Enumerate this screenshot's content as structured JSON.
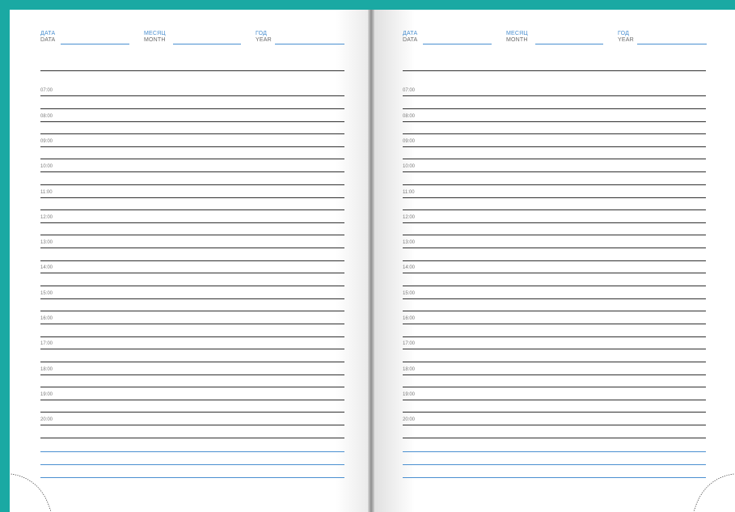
{
  "header_fields": [
    {
      "ru": "ДАТА",
      "en": "DATA"
    },
    {
      "ru": "МЕСЯЦ",
      "en": "MONTH"
    },
    {
      "ru": "ГОД",
      "en": "YEAR"
    }
  ],
  "times": [
    "07:00",
    "08:00",
    "09:00",
    "10:00",
    "11:00",
    "12:00",
    "13:00",
    "14:00",
    "15:00",
    "16:00",
    "17:00",
    "18:00",
    "19:00",
    "20:00"
  ],
  "colors": {
    "background": "#1aa9a3",
    "page": "#ffffff",
    "accent_blue": "#4a8fd0",
    "rule": "#2f2f2f"
  }
}
